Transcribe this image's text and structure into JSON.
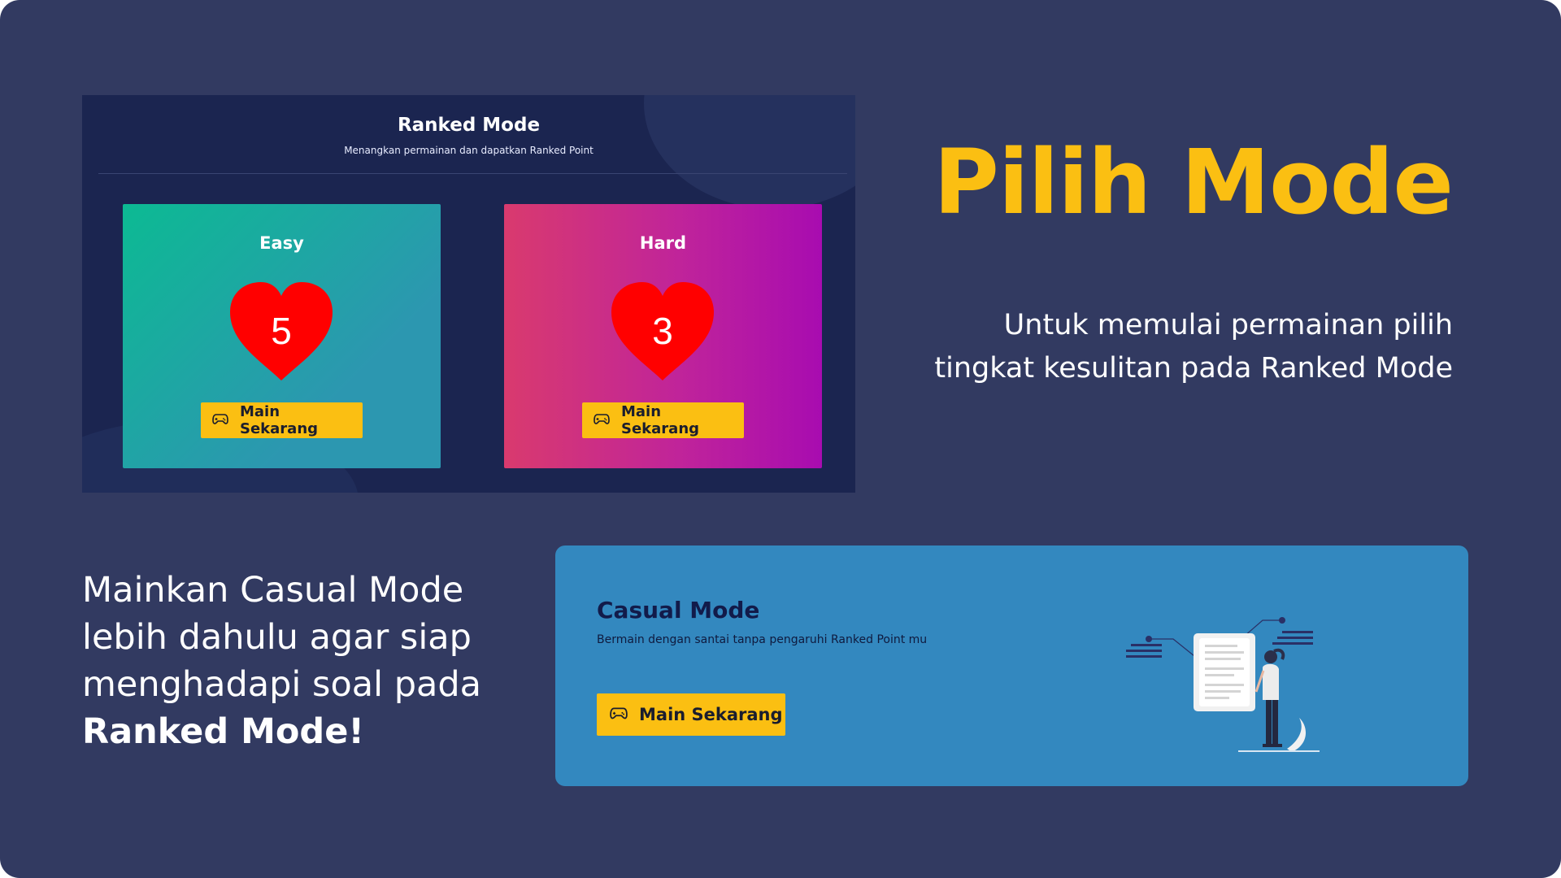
{
  "ranked": {
    "title": "Ranked Mode",
    "subtitle": "Menangkan permainan dan dapatkan Ranked Point",
    "modes": [
      {
        "label": "Easy",
        "lives": "5",
        "button": "Main Sekarang",
        "gradient": [
          "#0cba93",
          "#2c97b0"
        ]
      },
      {
        "label": "Hard",
        "lives": "3",
        "button": "Main Sekarang",
        "gradient": [
          "#d93a6e",
          "#a80cb0"
        ]
      }
    ]
  },
  "hero": {
    "headline": "Pilih Mode",
    "subtext_line1": "Untuk memulai permainan pilih",
    "subtext_line2": "tingkat kesulitan pada Ranked Mode"
  },
  "casual_promo": {
    "line1": "Mainkan Casual Mode",
    "line2": "lebih dahulu agar siap",
    "line3": "menghadapi soal pada",
    "emphasis": "Ranked Mode!"
  },
  "casual": {
    "title": "Casual Mode",
    "subtitle": "Bermain dengan santai tanpa pengaruhi Ranked Point mu",
    "button": "Main Sekarang"
  },
  "icons": {
    "button_icon": "gamepad-icon",
    "lives_icon": "heart-icon",
    "illustration": "woman-reading-document-illustration"
  },
  "colors": {
    "background": "#323a61",
    "accent": "#fbbf12",
    "heart": "#ff0000",
    "casual_panel": "#3388bf",
    "ranked_panel": "#1b2550"
  }
}
